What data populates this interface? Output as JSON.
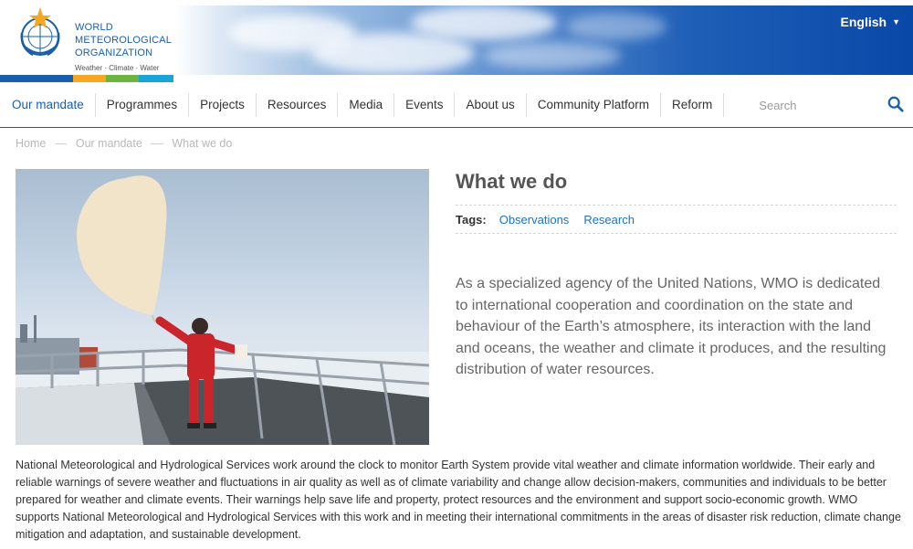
{
  "header": {
    "org_name": "WORLD METEOROLOGICAL ORGANIZATION",
    "tagline": "Weather · Climate · Water",
    "language": "English",
    "strip_colors": [
      "#1a5fab",
      "#f5a623",
      "#6cb33f",
      "#1ba4d8",
      "#ffffff"
    ]
  },
  "nav": {
    "items": [
      {
        "label": "Our mandate"
      },
      {
        "label": "Programmes"
      },
      {
        "label": "Projects"
      },
      {
        "label": "Resources"
      },
      {
        "label": "Media"
      },
      {
        "label": "Events"
      },
      {
        "label": "About us"
      },
      {
        "label": "Community Platform"
      },
      {
        "label": "Reform"
      }
    ],
    "search_placeholder": "Search",
    "accent": "#1a5fab"
  },
  "breadcrumb": {
    "items": [
      "Home",
      "Our mandate",
      "What we do"
    ],
    "separator": "—"
  },
  "page": {
    "title": "What we do",
    "tags_label": "Tags:",
    "tags": [
      "Observations",
      "Research"
    ],
    "intro": "As a specialized agency of the United Nations, WMO is dedicated to international cooperation and coordination on the state and behaviour of the Earth’s atmosphere, its interaction with the land and oceans, the weather and climate it produces, and the resulting distribution of water resources.",
    "body": "National Meteorological and Hydrological Services work around the clock to monitor Earth System provide vital weather and climate information worldwide. Their early and reliable warnings of severe weather and fluctuations in air quality as well as of climate variability and change allow decision-makers, communities and individuals to be better prepared for weather and climate events. Their warnings help save life and property, protect resources and the environment and support socio-economic growth. WMO supports National Meteorological and Hydrological Services with this work and in meeting their international commitments in the areas of disaster risk reduction, climate change mitigation and adaptation, and sustainable development."
  }
}
